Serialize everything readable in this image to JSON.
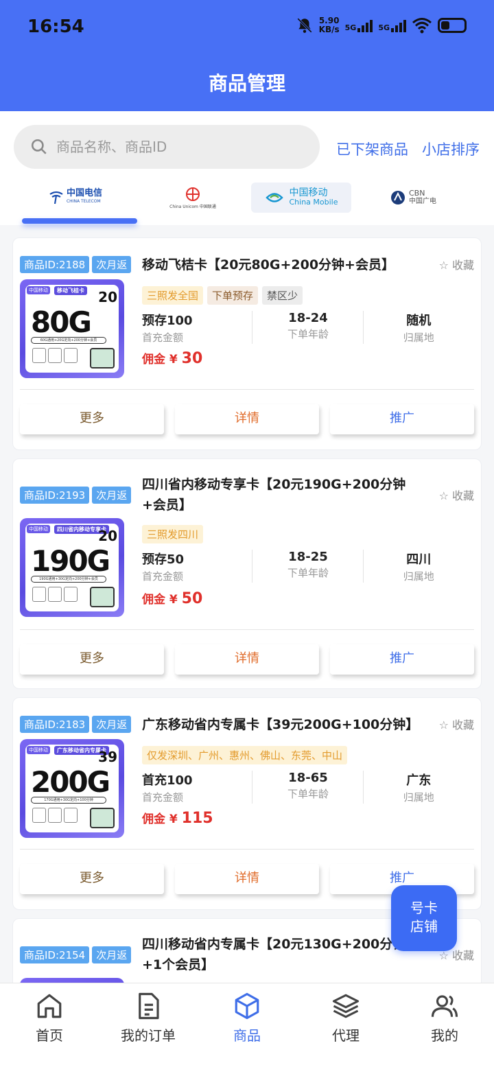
{
  "status": {
    "time": "16:54",
    "speed": "5.90",
    "speed_unit": "KB/s",
    "sig1": "5G",
    "sig2": "5G"
  },
  "header": {
    "title": "商品管理"
  },
  "search": {
    "placeholder": "商品名称、商品ID",
    "link_offline": "已下架商品",
    "link_sort": "小店排序"
  },
  "carriers": [
    {
      "name": "中国电信",
      "en": "CHINA TELECOM"
    },
    {
      "name": "中国联通",
      "en": "China Unicom"
    },
    {
      "name": "中国移动",
      "en": "China Mobile"
    },
    {
      "name": "中国广电",
      "en": "CBN"
    }
  ],
  "cards": [
    {
      "id": "商品ID:2188",
      "cashback": "次月返",
      "title": "移动飞桔卡【20元80G+200分钟+会员】",
      "fav": "☆ 收藏",
      "thumb": {
        "name": "移动飞桔卡",
        "price": "20",
        "big": "80G",
        "strip": "60G通用+20G定向+200分钟+会员"
      },
      "tags": [
        "三照发全国",
        "下单预存",
        "禁区少"
      ],
      "stats": [
        {
          "val": "预存100",
          "lbl": "首充金额"
        },
        {
          "val": "18-24",
          "lbl": "下单年龄"
        },
        {
          "val": "随机",
          "lbl": "归属地"
        }
      ],
      "commission_label": "佣金 ¥ ",
      "commission": "30",
      "btn_more": "更多",
      "btn_detail": "详情",
      "btn_promote": "推广"
    },
    {
      "id": "商品ID:2193",
      "cashback": "次月返",
      "title": "四川省内移动专享卡【20元190G+200分钟+会员】",
      "fav": "☆ 收藏",
      "thumb": {
        "name": "四川省内移动专享卡",
        "price": "20",
        "big": "190G",
        "strip": "190G通用+30G定向+200分钟+会员"
      },
      "tags": [
        "三照发四川"
      ],
      "stats": [
        {
          "val": "预存50",
          "lbl": "首充金额"
        },
        {
          "val": "18-25",
          "lbl": "下单年龄"
        },
        {
          "val": "四川",
          "lbl": "归属地"
        }
      ],
      "commission_label": "佣金 ¥ ",
      "commission": "50",
      "btn_more": "更多",
      "btn_detail": "详情",
      "btn_promote": "推广"
    },
    {
      "id": "商品ID:2183",
      "cashback": "次月返",
      "title": "广东移动省内专属卡【39元200G+100分钟】",
      "fav": "☆ 收藏",
      "thumb": {
        "name": "广东移动省内专属卡",
        "price": "39",
        "big": "200G",
        "strip": "170G通用+30G定向+100分钟"
      },
      "tags": [
        "仅发深圳、广州、惠州、佛山、东莞、中山"
      ],
      "stats": [
        {
          "val": "首充100",
          "lbl": "首充金额"
        },
        {
          "val": "18-65",
          "lbl": "下单年龄"
        },
        {
          "val": "广东",
          "lbl": "归属地"
        }
      ],
      "commission_label": "佣金 ¥ ",
      "commission": "115",
      "btn_more": "更多",
      "btn_detail": "详情",
      "btn_promote": "推广"
    },
    {
      "id": "商品ID:2154",
      "cashback": "次月返",
      "title": "四川移动省内专属卡【20元130G+200分钟+1个会员】",
      "fav": "☆ 收藏"
    }
  ],
  "float_shop": {
    "line1": "号卡",
    "line2": "店铺"
  },
  "tabs": [
    {
      "label": "首页",
      "icon": "home-icon"
    },
    {
      "label": "我的订单",
      "icon": "document-icon"
    },
    {
      "label": "商品",
      "icon": "box-icon"
    },
    {
      "label": "代理",
      "icon": "layers-icon"
    },
    {
      "label": "我的",
      "icon": "users-icon"
    }
  ],
  "colors": {
    "primary": "#4870f5",
    "commission": "#e0302b",
    "link": "#3f6ee8"
  }
}
